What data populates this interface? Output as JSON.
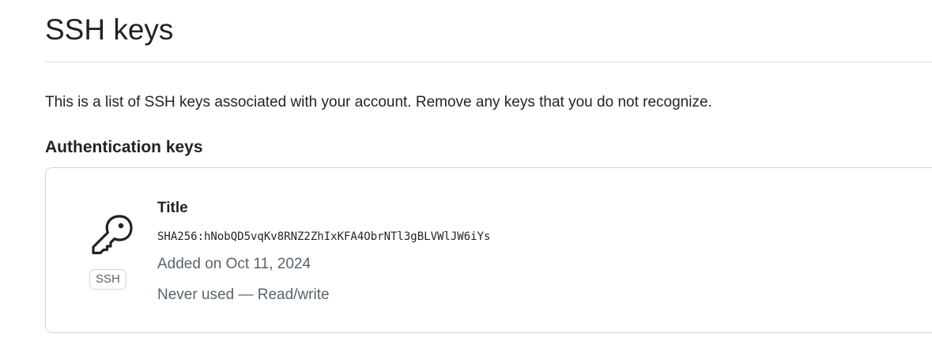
{
  "page": {
    "title": "SSH keys",
    "description": "This is a list of SSH keys associated with your account. Remove any keys that you do not recognize."
  },
  "authentication_keys": {
    "heading": "Authentication keys",
    "keys": [
      {
        "icon": "key-icon",
        "badge": "SSH",
        "title": "Title",
        "fingerprint": "SHA256:hNobQD5vqKv8RNZ2ZhIxKFA4ObrNTl3gBLVWlJW6iYs",
        "added": "Added on Oct 11, 2024",
        "usage": "Never used — Read/write"
      }
    ]
  },
  "colors": {
    "text_primary": "#1f2328",
    "text_muted": "#59636e",
    "border": "#d0d7de"
  }
}
